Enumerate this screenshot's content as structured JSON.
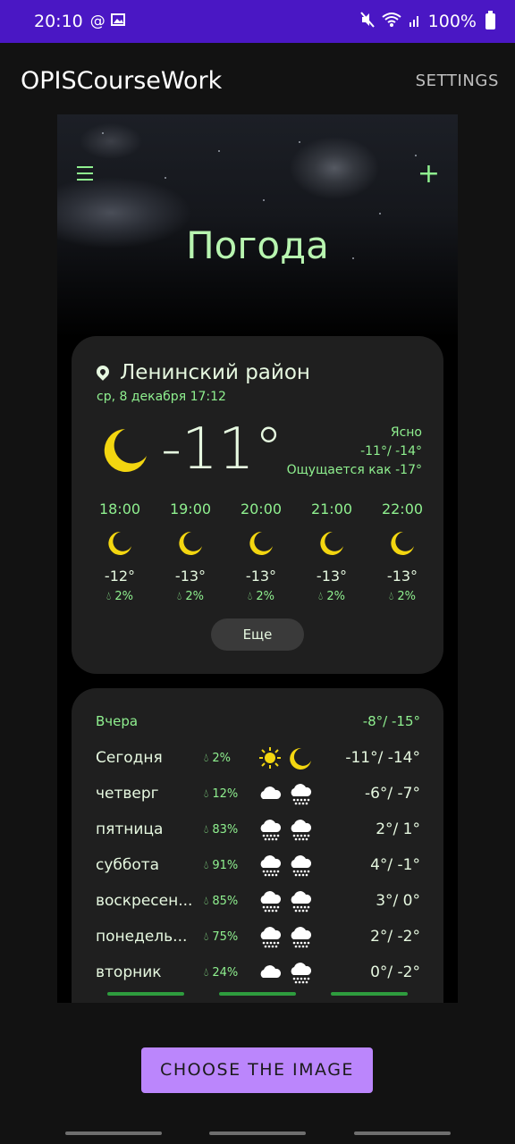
{
  "status": {
    "time": "20:10",
    "battery": "100%",
    "icons": [
      "at-icon",
      "image-icon",
      "mute-icon",
      "wifi-icon",
      "signal-icon",
      "battery-icon"
    ]
  },
  "app": {
    "title": "OPISCourseWork",
    "settings_label": "SETTINGS"
  },
  "weather": {
    "title": "Погода",
    "location": "Ленинский район",
    "datetime": "ср, 8 декабря 17:12",
    "temp": "-11°",
    "condition": "Ясно",
    "range": "-11°/ -14°",
    "feels_like": "Ощущается как -17°",
    "more_label": "Еще",
    "hourly": [
      {
        "time": "18:00",
        "temp": "-12°",
        "pop": "2%"
      },
      {
        "time": "19:00",
        "temp": "-13°",
        "pop": "2%"
      },
      {
        "time": "20:00",
        "temp": "-13°",
        "pop": "2%"
      },
      {
        "time": "21:00",
        "temp": "-13°",
        "pop": "2%"
      },
      {
        "time": "22:00",
        "temp": "-13°",
        "pop": "2%"
      }
    ],
    "yesterday": {
      "label": "Вчера",
      "temps": "-8°/ -15°"
    },
    "daily": [
      {
        "day": "Сегодня",
        "pop": "2%",
        "icon1": "sun-icon",
        "icon2": "moon-icon",
        "temps": "-11°/ -14°"
      },
      {
        "day": "четверг",
        "pop": "12%",
        "icon1": "cloud-icon",
        "icon2": "snow-cloud-icon",
        "temps": "-6°/ -7°"
      },
      {
        "day": "пятница",
        "pop": "83%",
        "icon1": "snow-cloud-icon",
        "icon2": "snow-cloud-icon",
        "temps": "2°/ 1°"
      },
      {
        "day": "суббота",
        "pop": "91%",
        "icon1": "snow-cloud-icon",
        "icon2": "snow-cloud-icon",
        "temps": "4°/ -1°"
      },
      {
        "day": "воскресен...",
        "pop": "85%",
        "icon1": "snow-cloud-icon",
        "icon2": "snow-cloud-icon",
        "temps": "3°/ 0°"
      },
      {
        "day": "понедель...",
        "pop": "75%",
        "icon1": "snow-cloud-icon",
        "icon2": "snow-cloud-icon",
        "temps": "2°/ -2°"
      },
      {
        "day": "вторник",
        "pop": "24%",
        "icon1": "cloud-icon",
        "icon2": "snow-cloud-icon",
        "temps": "0°/ -2°"
      }
    ]
  },
  "button": {
    "choose_label": "CHOOSE THE IMAGE"
  },
  "colors": {
    "status_bar": "#4a17c4",
    "accent_green": "#8ff08f",
    "button": "#bb86fc",
    "moon": "#f3d610"
  }
}
